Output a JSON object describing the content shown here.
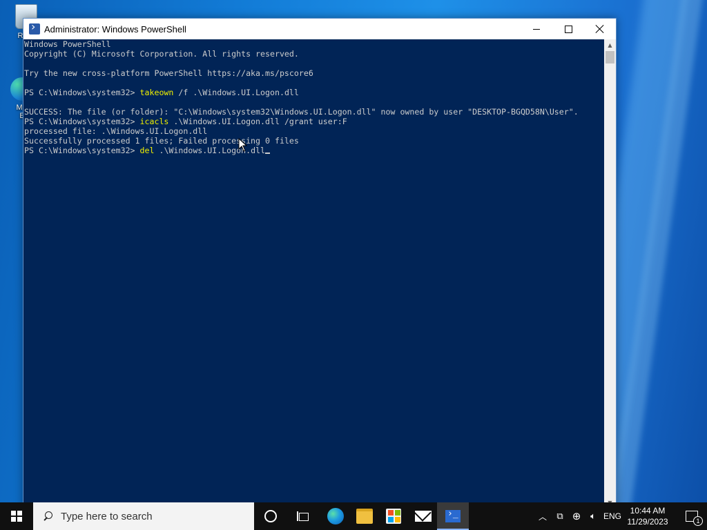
{
  "desktop": {
    "icons": [
      {
        "label": "Recy"
      },
      {
        "label": "Mic\nE"
      }
    ]
  },
  "window": {
    "title": "Administrator: Windows PowerShell",
    "console_lines": [
      {
        "text": "Windows PowerShell"
      },
      {
        "text": "Copyright (C) Microsoft Corporation. All rights reserved."
      },
      {
        "text": ""
      },
      {
        "text": "Try the new cross-platform PowerShell https://aka.ms/pscore6"
      },
      {
        "text": ""
      },
      {
        "prompt": "PS C:\\Windows\\system32> ",
        "cmd": "takeown",
        "args": " /f .\\Windows.UI.Logon.dll"
      },
      {
        "text": ""
      },
      {
        "text": "SUCCESS: The file (or folder): \"C:\\Windows\\system32\\Windows.UI.Logon.dll\" now owned by user \"DESKTOP-BGQD58N\\User\"."
      },
      {
        "prompt": "PS C:\\Windows\\system32> ",
        "cmd": "icacls",
        "args": " .\\Windows.UI.Logon.dll /grant user:F"
      },
      {
        "text": "processed file: .\\Windows.UI.Logon.dll"
      },
      {
        "text": "Successfully processed 1 files; Failed processing 0 files"
      },
      {
        "prompt": "PS C:\\Windows\\system32> ",
        "cmd": "del",
        "args": " .\\Windows.UI.Logon.dll"
      }
    ]
  },
  "taskbar": {
    "search_placeholder": "Type here to search",
    "language": "ENG",
    "time": "10:44 AM",
    "date": "11/29/2023",
    "notification_count": "1"
  },
  "colors": {
    "console_bg": "#012456",
    "console_fg": "#cccccc",
    "command": "#f0f000",
    "taskbar": "#101010"
  }
}
